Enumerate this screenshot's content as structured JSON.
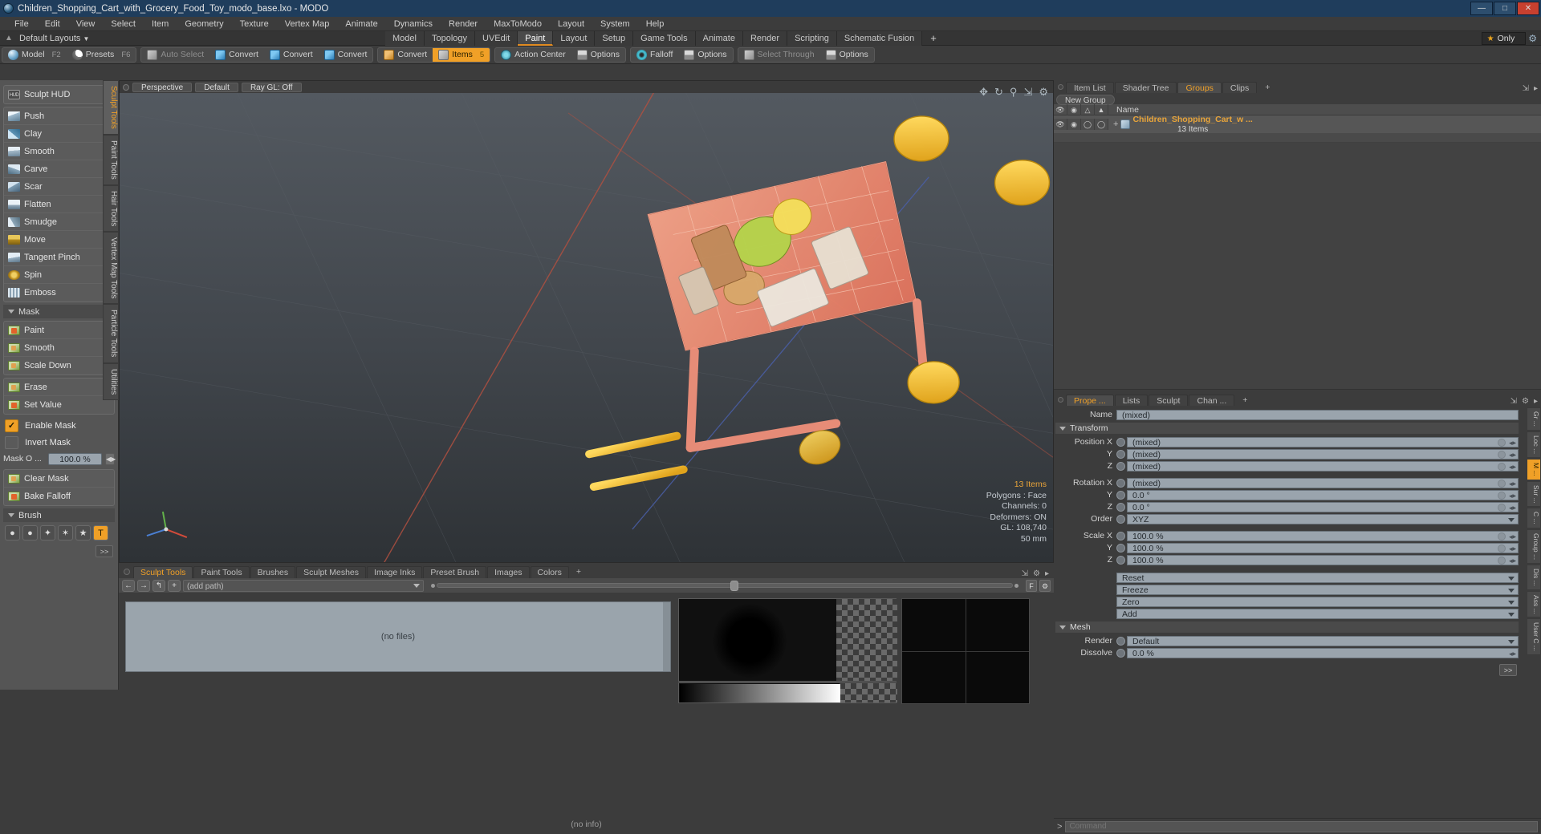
{
  "window": {
    "title": "Children_Shopping_Cart_with_Grocery_Food_Toy_modo_base.lxo - MODO",
    "minimize": "—",
    "maximize": "□",
    "close": "✕"
  },
  "menubar": {
    "items": [
      "File",
      "Edit",
      "View",
      "Select",
      "Item",
      "Geometry",
      "Texture",
      "Vertex Map",
      "Animate",
      "Dynamics",
      "Render",
      "MaxToModo",
      "Layout",
      "System",
      "Help"
    ]
  },
  "layout_row": {
    "default_layouts": "Default Layouts",
    "tabs": [
      "Model",
      "Topology",
      "UVEdit",
      "Paint",
      "Layout",
      "Setup",
      "Game Tools",
      "Animate",
      "Render",
      "Scripting",
      "Schematic Fusion"
    ],
    "active_tab": "Paint",
    "plus": "+",
    "only_label": "Only",
    "star": "★",
    "gear": "⚙"
  },
  "toolbar": {
    "groups": [
      {
        "buttons": [
          {
            "label": "Model",
            "key": "F2",
            "icon": "sphere-icon",
            "state": "normal"
          },
          {
            "label": "Presets",
            "key": "F6",
            "icon": "presets-icon",
            "state": "normal"
          }
        ]
      },
      {
        "buttons": [
          {
            "label": "Auto Select",
            "key": "",
            "icon": "cube-icon",
            "state": "dim"
          },
          {
            "label": "Convert",
            "key": "",
            "icon": "convert-icon",
            "state": "normal"
          },
          {
            "label": "Convert",
            "key": "",
            "icon": "convert-icon",
            "state": "normal"
          },
          {
            "label": "Convert",
            "key": "",
            "icon": "convert-icon",
            "state": "normal"
          }
        ]
      },
      {
        "buttons": [
          {
            "label": "Convert",
            "key": "",
            "icon": "convert-orange-icon",
            "state": "normal"
          },
          {
            "label": "Items",
            "key": "5",
            "icon": "items-icon",
            "state": "active"
          }
        ]
      },
      {
        "buttons": [
          {
            "label": "Action Center",
            "key": "",
            "icon": "action-center-icon",
            "state": "normal"
          },
          {
            "label": "Options",
            "key": "",
            "icon": "options-icon",
            "state": "normal"
          }
        ]
      },
      {
        "buttons": [
          {
            "label": "Falloff",
            "key": "",
            "icon": "falloff-icon",
            "state": "normal"
          },
          {
            "label": "Options",
            "key": "",
            "icon": "options-icon",
            "state": "normal"
          }
        ]
      },
      {
        "buttons": [
          {
            "label": "Select Through",
            "key": "",
            "icon": "select-through-icon",
            "state": "dim"
          },
          {
            "label": "Options",
            "key": "",
            "icon": "options-icon",
            "state": "normal"
          }
        ]
      }
    ]
  },
  "left_panel": {
    "hud": {
      "label": "Sculpt HUD",
      "icon": "hud-icon"
    },
    "sculpt_tools": [
      {
        "label": "Push",
        "icon": "push-icon",
        "corner": true
      },
      {
        "label": "Clay",
        "icon": "clay-icon",
        "corner": false
      },
      {
        "label": "Smooth",
        "icon": "smooth-icon",
        "corner": false
      },
      {
        "label": "Carve",
        "icon": "carve-icon",
        "corner": false
      },
      {
        "label": "Scar",
        "icon": "scar-icon",
        "corner": false
      },
      {
        "label": "Flatten",
        "icon": "flatten-icon",
        "corner": false
      },
      {
        "label": "Smudge",
        "icon": "smudge-icon",
        "corner": false
      },
      {
        "label": "Move",
        "icon": "move-icon",
        "corner": false
      },
      {
        "label": "Tangent Pinch",
        "icon": "tangent-pinch-icon",
        "corner": true
      },
      {
        "label": "Spin",
        "icon": "spin-icon",
        "corner": false
      },
      {
        "label": "Emboss",
        "icon": "emboss-icon",
        "corner": true
      }
    ],
    "mask_section": "Mask",
    "mask_tools": [
      {
        "label": "Paint",
        "icon": "mask-paint-icon"
      },
      {
        "label": "Smooth",
        "icon": "mask-smooth-icon"
      },
      {
        "label": "Scale Down",
        "icon": "mask-scale-down-icon"
      }
    ],
    "mask_tools2": [
      {
        "label": "Erase",
        "icon": "mask-erase-icon"
      },
      {
        "label": "Set Value",
        "icon": "mask-set-value-icon"
      }
    ],
    "enable_mask": {
      "label": "Enable Mask",
      "checked": true
    },
    "invert_mask": {
      "label": "Invert Mask",
      "checked": false
    },
    "mask_opacity": {
      "label": "Mask O  ...",
      "value": "100.0 %"
    },
    "mask_actions": [
      {
        "label": "Clear Mask",
        "icon": "clear-mask-icon"
      },
      {
        "label": "Bake Falloff",
        "icon": "bake-falloff-icon"
      }
    ],
    "brush_section": "Brush",
    "brush_shapes": [
      "●",
      "●",
      "✦",
      "✶",
      "★",
      "T"
    ],
    "brush_active_index": 5,
    "more": ">>"
  },
  "vertical_tabs": {
    "items": [
      "Sculpt Tools",
      "Paint Tools",
      "Hair Tools",
      "Vertex Map Tools",
      "Particle Tools",
      "Utilities"
    ],
    "active": "Sculpt Tools"
  },
  "viewport": {
    "buttons": [
      "Perspective",
      "Default",
      "Ray GL: Off"
    ],
    "icons": [
      "move-icon",
      "rotate-icon",
      "zoom-icon",
      "fit-icon",
      "gear-icon"
    ],
    "info": {
      "items": "13 Items",
      "polygons": "Polygons : Face",
      "channels": "Channels: 0",
      "deformers": "Deformers: ON",
      "gl": "GL: 108,740",
      "units": "50 mm"
    }
  },
  "bottom_panel": {
    "tabs": [
      "Sculpt Tools",
      "Paint Tools",
      "Brushes",
      "Sculpt Meshes",
      "Image Inks",
      "Preset Brush",
      "Images",
      "Colors"
    ],
    "active_tab": "Sculpt Tools",
    "plus": "+",
    "nav": [
      "←",
      "→",
      "↰",
      "+"
    ],
    "path_value": "(add path)",
    "filter_button": "F",
    "gear_button": "⚙",
    "files_empty": "(no files)",
    "status": "(no info)"
  },
  "right_panel": {
    "tabs": [
      "Item List",
      "Shader Tree",
      "Groups",
      "Clips"
    ],
    "active_tab": "Groups",
    "plus": "+",
    "new_group": "New Group",
    "columns": [
      "eye-icon",
      "render-icon",
      "shade-icon",
      "wire-icon",
      "Name"
    ],
    "row": {
      "name": "Children_Shopping_Cart_w ...",
      "count": "13 Items"
    }
  },
  "properties": {
    "tabs": [
      "Prope ...",
      "Lists",
      "Sculpt",
      "Chan ..."
    ],
    "active_tab": "Prope ...",
    "plus": "+",
    "name_label": "Name",
    "name_value": "(mixed)",
    "transform_section": "Transform",
    "fields": [
      {
        "label": "Position X",
        "value": "(mixed)",
        "type": "num"
      },
      {
        "label": "Y",
        "value": "(mixed)",
        "type": "num"
      },
      {
        "label": "Z",
        "value": "(mixed)",
        "type": "num"
      },
      {
        "label": "Rotation X",
        "value": "(mixed)",
        "type": "num"
      },
      {
        "label": "Y",
        "value": "0.0 °",
        "type": "num"
      },
      {
        "label": "Z",
        "value": "0.0 °",
        "type": "num"
      },
      {
        "label": "Order",
        "value": "XYZ",
        "type": "drop"
      },
      {
        "label": "Scale X",
        "value": "100.0 %",
        "type": "num"
      },
      {
        "label": "Y",
        "value": "100.0 %",
        "type": "num"
      },
      {
        "label": "Z",
        "value": "100.0 %",
        "type": "num"
      }
    ],
    "actions": [
      {
        "label": "Reset"
      },
      {
        "label": "Freeze"
      },
      {
        "label": "Zero"
      },
      {
        "label": "Add"
      }
    ],
    "mesh_section": "Mesh",
    "mesh_fields": [
      {
        "label": "Render",
        "value": "Default",
        "type": "drop"
      },
      {
        "label": "Dissolve",
        "value": "0.0 %",
        "type": "num"
      }
    ],
    "more": ">>",
    "side_tabs": [
      "Gr ...",
      "Loc ...",
      "M ...",
      "Sur ...",
      "C ...",
      "Group ...",
      "Dis ...",
      "Ass ...",
      "User C ..."
    ],
    "side_active": "M ..."
  },
  "command_bar": {
    "prompt": ">",
    "placeholder": "Command"
  },
  "colors": {
    "accent": "#f0a027",
    "title_bg": "#1f3d5c",
    "panel_bg": "#3c3c3c",
    "left_panel_bg": "#555555",
    "field_bg": "#9aa4ad",
    "close_red": "#c7402f"
  }
}
